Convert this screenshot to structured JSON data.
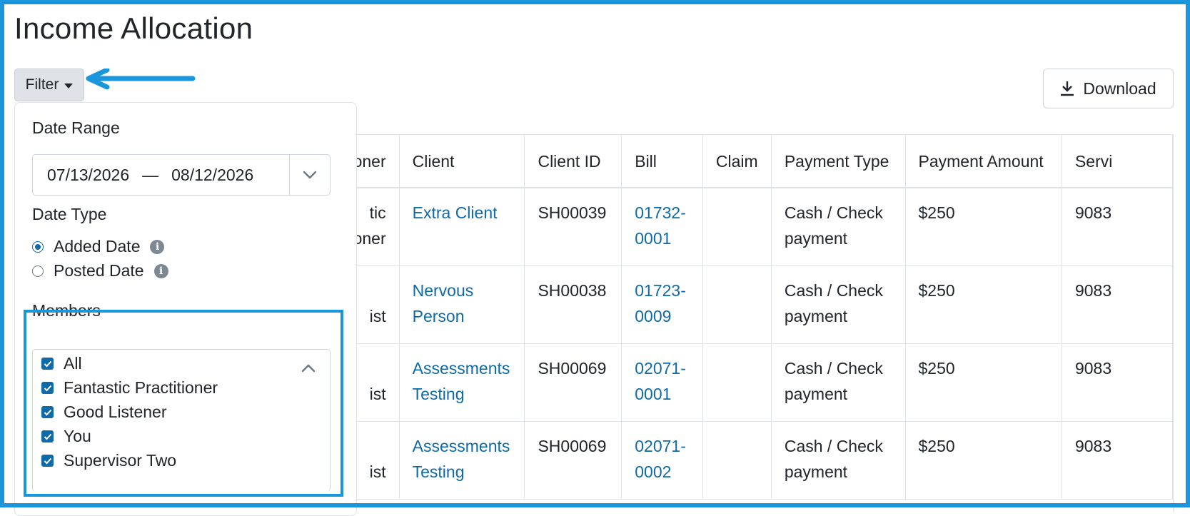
{
  "page": {
    "title": "Income Allocation"
  },
  "toolbar": {
    "filter_label": "Filter",
    "download_label": "Download"
  },
  "filter_panel": {
    "date_range_label": "Date Range",
    "date_start": "07/13/2026",
    "date_separator": "—",
    "date_end": "08/12/2026",
    "date_type_label": "Date Type",
    "date_type_options": [
      {
        "label": "Added Date",
        "checked": true
      },
      {
        "label": "Posted Date",
        "checked": false
      }
    ],
    "members_label": "Members",
    "members": [
      {
        "label": "All",
        "checked": true
      },
      {
        "label": "Fantastic Practitioner",
        "checked": true
      },
      {
        "label": "Good Listener",
        "checked": true
      },
      {
        "label": "You",
        "checked": true
      },
      {
        "label": "Supervisor Two",
        "checked": true
      }
    ]
  },
  "table": {
    "columns": [
      "tioner",
      "Client",
      "Client ID",
      "Bill",
      "Claim",
      "Payment Type",
      "Payment Amount",
      "Servi"
    ],
    "rows": [
      {
        "practitioner": "tic\noner",
        "client": "Extra Client",
        "client_id": "SH00039",
        "bill": "01732-\n0001",
        "claim": "",
        "payment_type": "Cash / Check\npayment",
        "amount": "$250",
        "service": "9083"
      },
      {
        "practitioner": "\nist",
        "client": "Nervous\nPerson",
        "client_id": "SH00038",
        "bill": "01723-\n0009",
        "claim": "",
        "payment_type": "Cash / Check\npayment",
        "amount": "$250",
        "service": "9083"
      },
      {
        "practitioner": "\nist",
        "client": "Assessments\nTesting",
        "client_id": "SH00069",
        "bill": "02071-\n0001",
        "claim": "",
        "payment_type": "Cash / Check\npayment",
        "amount": "$250",
        "service": "9083"
      },
      {
        "practitioner": "\nist",
        "client": "Assessments\nTesting",
        "client_id": "SH00069",
        "bill": "02071-\n0002",
        "claim": "",
        "payment_type": "Cash / Check\npayment",
        "amount": "$250",
        "service": "9083"
      }
    ]
  },
  "colors": {
    "annotation": "#1a96dc",
    "link": "#0e6aa8",
    "checkbox": "#0e6aa8"
  },
  "icons": [
    "caret-down-icon",
    "download-icon",
    "chevron-down-icon",
    "info-icon",
    "chevron-up-icon",
    "checkbox-checked-icon",
    "annotation-arrow-icon"
  ]
}
